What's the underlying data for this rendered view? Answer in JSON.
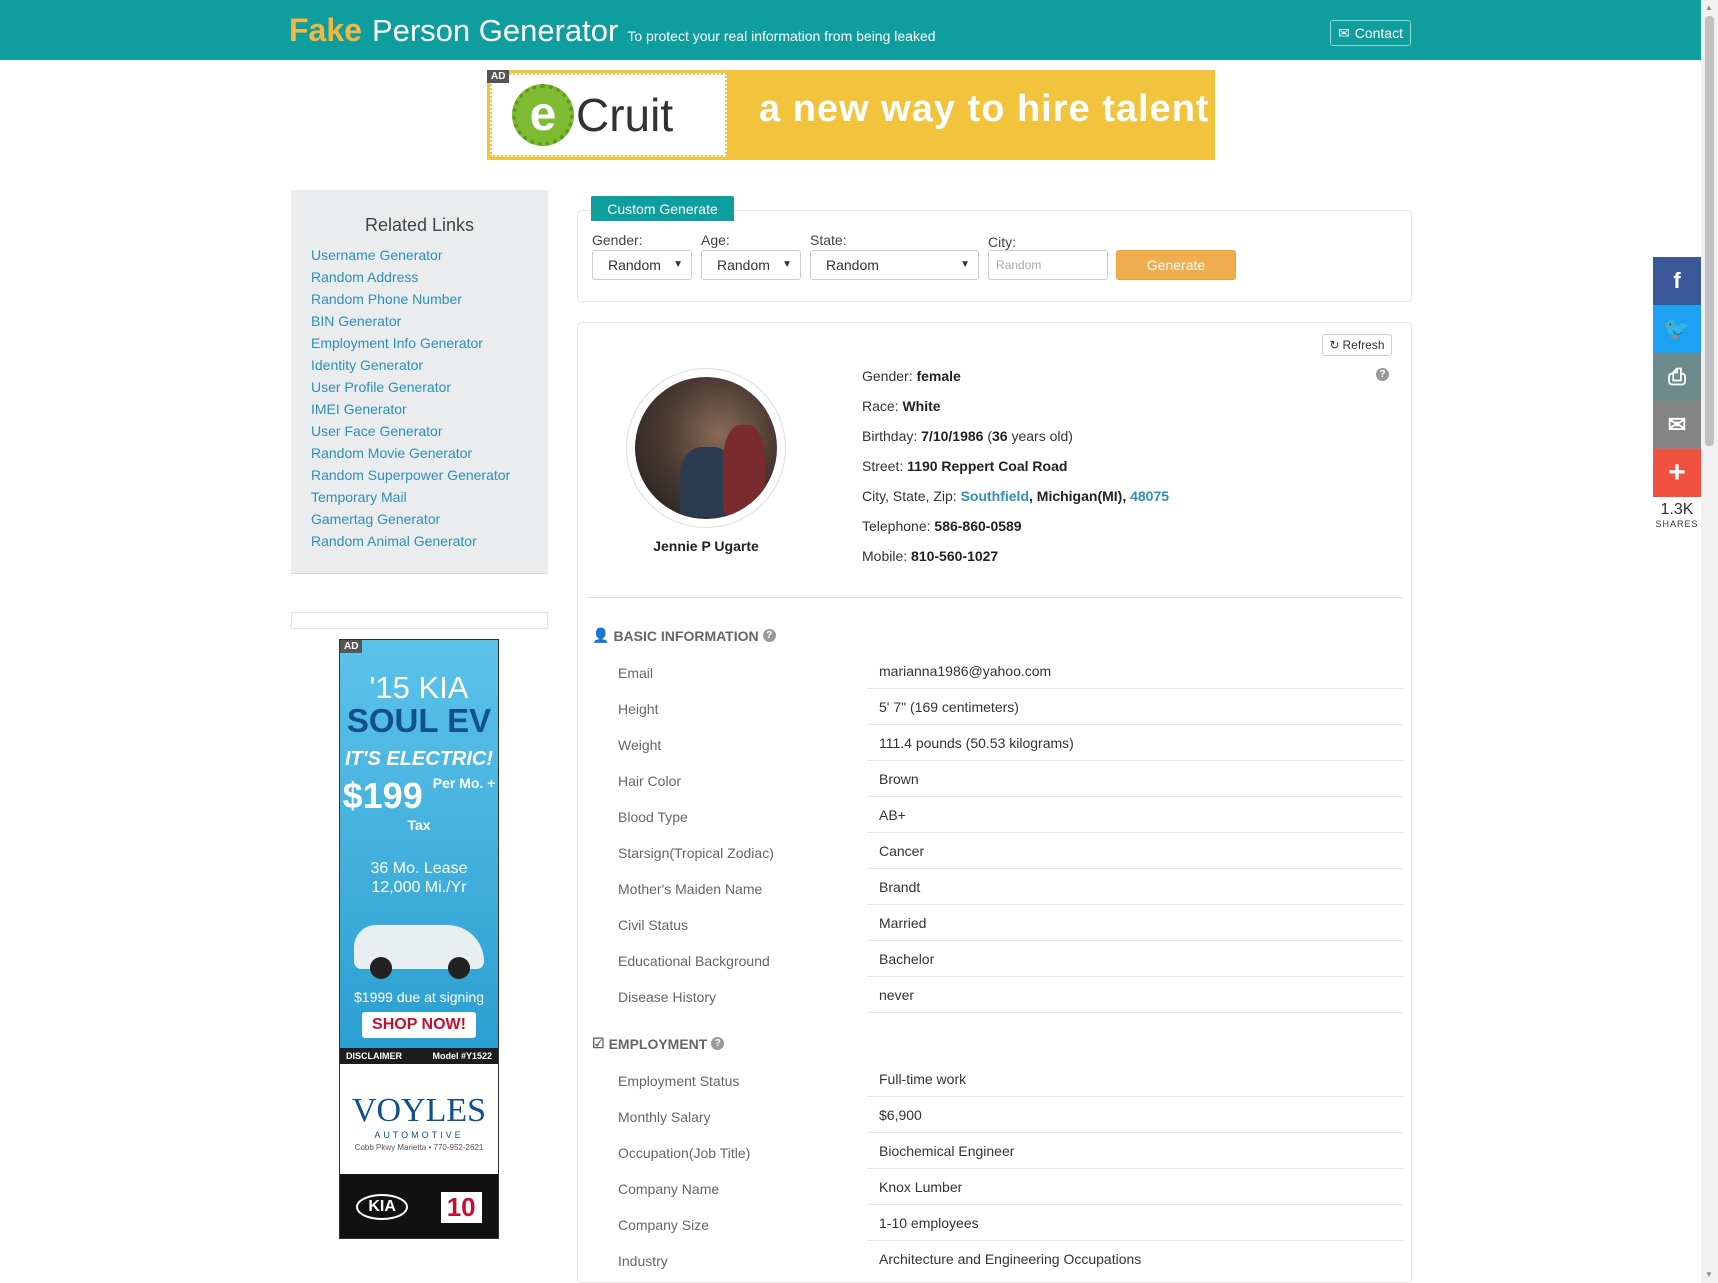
{
  "header": {
    "brand_fake": "Fake",
    "brand_rest": "Person Generator",
    "tagline": "To protect your real information from being leaked",
    "contact_label": "Contact"
  },
  "top_ad": {
    "badge": "AD",
    "logo_letter": "e",
    "logo_text": "Cruit",
    "slogan": "a new way to hire talent"
  },
  "sidebar": {
    "title": "Related Links",
    "links": [
      "Username Generator",
      "Random Address",
      "Random Phone Number",
      "BIN Generator",
      "Employment Info Generator",
      "Identity Generator",
      "User Profile Generator",
      "IMEI Generator",
      "User Face Generator",
      "Random Movie Generator",
      "Random Superpower Generator",
      "Temporary Mail",
      "Gamertag Generator",
      "Random Animal Generator"
    ]
  },
  "side_ad": {
    "badge": "AD",
    "year": "'15 KIA",
    "model": "SOUL EV",
    "electric": "IT'S ELECTRIC!",
    "price": "$199",
    "per": "Per Mo. + Tax",
    "lease1": "36 Mo. Lease",
    "lease2": "12,000 Mi./Yr",
    "due": "$1999 due at signing",
    "shop": "SHOP NOW!",
    "disclaimer": "DISCLAIMER",
    "model_no": "Model #Y1522",
    "dealer": "VOYLES",
    "dealer_sub": "AUTOMOTIVE",
    "dealer_addr": "Cobb Pkwy Marietta • 770-952-2621",
    "kia": "KIA",
    "warranty": "10"
  },
  "custom_generate": {
    "tab_label": "Custom Generate",
    "gender_label": "Gender:",
    "gender_value": "Random",
    "age_label": "Age:",
    "age_value": "Random",
    "state_label": "State:",
    "state_value": "Random",
    "city_label": "City:",
    "city_placeholder": "Random",
    "generate_label": "Generate"
  },
  "person": {
    "refresh_label": "Refresh",
    "name": "Jennie P Ugarte",
    "gender_label": "Gender:",
    "gender": "female",
    "race_label": "Race:",
    "race": "White",
    "birthday_label": "Birthday:",
    "birthday": "7/10/1986",
    "age_open": "(",
    "age": "36",
    "age_suffix": "years old)",
    "street_label": "Street:",
    "street": "1190 Reppert Coal Road",
    "csz_label": "City, State, Zip:",
    "city": "Southfield",
    "state": "Michigan(MI)",
    "zip": "48075",
    "telephone_label": "Telephone:",
    "telephone": "586-860-0589",
    "mobile_label": "Mobile:",
    "mobile": "810-560-1027"
  },
  "basic_info": {
    "heading": "BASIC INFORMATION",
    "rows": [
      {
        "label": "Email",
        "value": "marianna1986@yahoo.com"
      },
      {
        "label": "Height",
        "value": "5' 7\" (169 centimeters)"
      },
      {
        "label": "Weight",
        "value": "111.4 pounds (50.53 kilograms)"
      },
      {
        "label": "Hair Color",
        "value": "Brown"
      },
      {
        "label": "Blood Type",
        "value": "AB+"
      },
      {
        "label": "Starsign(Tropical Zodiac)",
        "value": "Cancer"
      },
      {
        "label": "Mother's Maiden Name",
        "value": "Brandt"
      },
      {
        "label": "Civil Status",
        "value": "Married"
      },
      {
        "label": "Educational Background",
        "value": "Bachelor"
      },
      {
        "label": "Disease History",
        "value": "never"
      }
    ]
  },
  "employment": {
    "heading": "EMPLOYMENT",
    "rows": [
      {
        "label": "Employment Status",
        "value": "Full-time work"
      },
      {
        "label": "Monthly Salary",
        "value": "$6,900"
      },
      {
        "label": "Occupation(Job Title)",
        "value": "Biochemical Engineer"
      },
      {
        "label": "Company Name",
        "value": "Knox Lumber"
      },
      {
        "label": "Company Size",
        "value": "1-10 employees"
      },
      {
        "label": "Industry",
        "value": "Architecture and Engineering Occupations"
      }
    ]
  },
  "social": {
    "count": "1.3K",
    "label": "SHARES"
  },
  "colors": {
    "brand_teal": "#0e9e9d",
    "brand_gold": "#f4b73f",
    "link_blue": "#2e8fb8",
    "generate_orange": "#f0ad4e"
  }
}
